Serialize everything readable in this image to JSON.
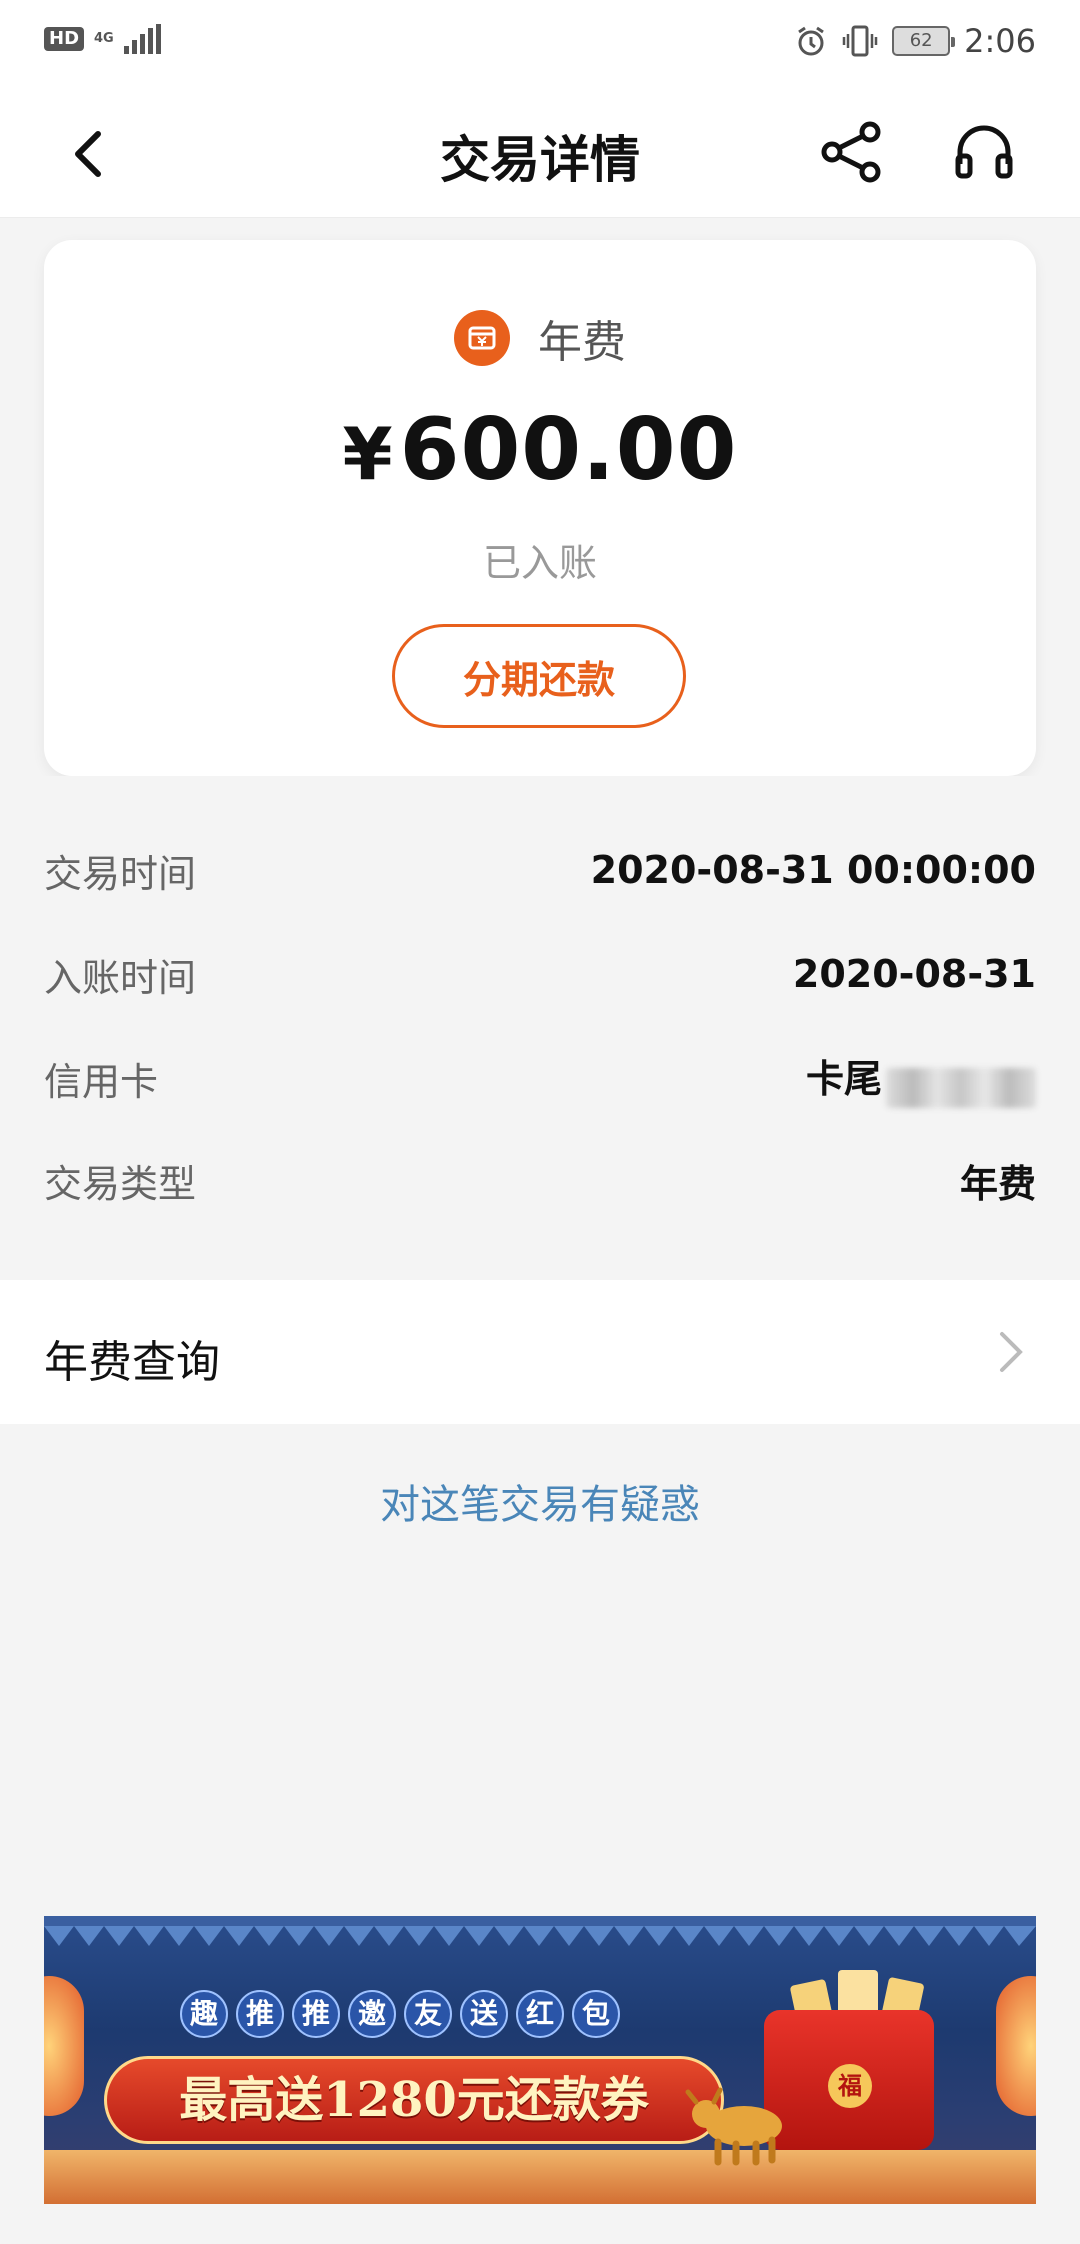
{
  "status_bar": {
    "hd_label": "HD",
    "network_label": "4G",
    "battery": "62",
    "time": "2:06"
  },
  "header": {
    "title": "交易详情"
  },
  "summary": {
    "category_label": "年费",
    "currency": "¥",
    "amount": "600.00",
    "status": "已入账",
    "installment_button": "分期还款",
    "accent_color": "#e8601c"
  },
  "details": [
    {
      "key": "交易时间",
      "value": "2020-08-31 00:00:00"
    },
    {
      "key": "入账时间",
      "value": "2020-08-31"
    },
    {
      "key": "信用卡",
      "value": "卡尾"
    },
    {
      "key": "交易类型",
      "value": "年费"
    }
  ],
  "annual_fee_query": {
    "label": "年费查询"
  },
  "doubt_link": "对这笔交易有疑惑",
  "banner": {
    "subtitle_chars": [
      "趣",
      "推",
      "推",
      "邀",
      "友",
      "送",
      "红",
      "包"
    ],
    "headline": "最高送1280元还款券",
    "fu": "福"
  }
}
